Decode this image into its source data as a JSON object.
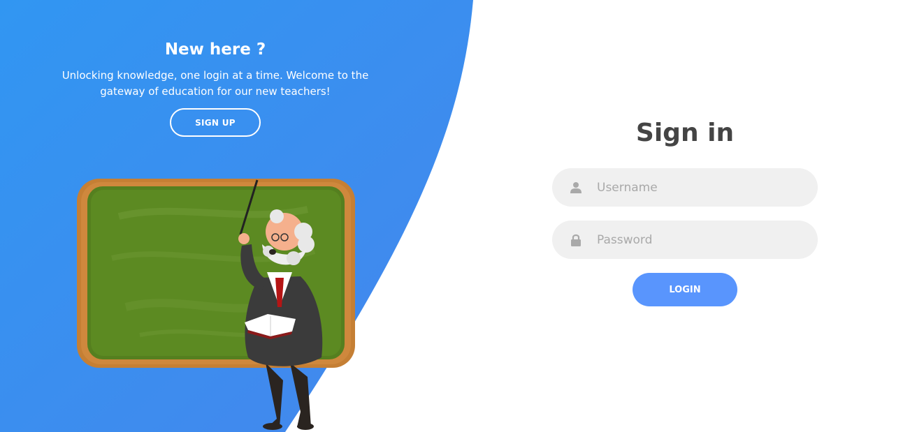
{
  "colors": {
    "accent": "#5995fd",
    "panel_blue": "#3a8ef0",
    "input_bg": "#f0f0f0",
    "title_text": "#444444"
  },
  "left_panel": {
    "title": "New here ?",
    "description": "Unlocking knowledge, one login at a time. Welcome to the gateway of education for our new teachers!",
    "signup_label": "SIGN UP",
    "illustration": "teacher-at-chalkboard"
  },
  "signin": {
    "title": "Sign in",
    "username": {
      "placeholder": "Username",
      "value": "",
      "icon": "user-icon"
    },
    "password": {
      "placeholder": "Password",
      "value": "",
      "icon": "lock-icon"
    },
    "login_label": "LOGIN"
  }
}
